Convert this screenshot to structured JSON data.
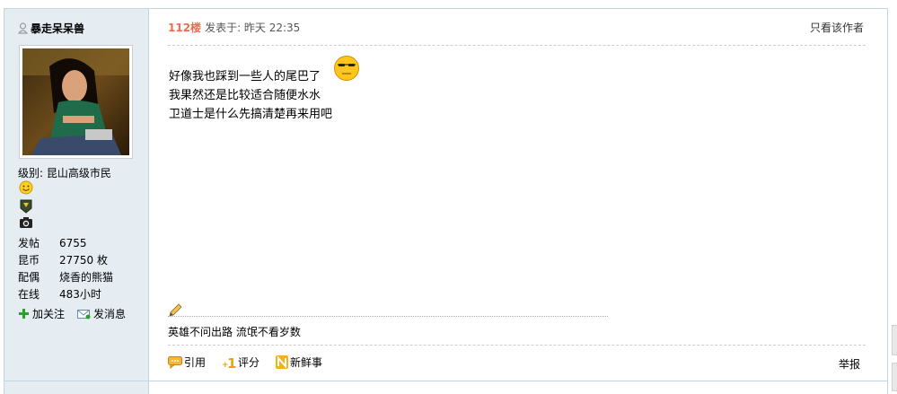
{
  "user": {
    "name": "暴走呆呆兽",
    "level_label": "级别: ",
    "level_value": "昆山高级市民",
    "stats": [
      {
        "label": "发帖",
        "value": "6755"
      },
      {
        "label": "昆币",
        "value": "27750 枚"
      },
      {
        "label": "配偶",
        "value": "烧香的熊猫"
      },
      {
        "label": "在线",
        "value": "483小时"
      }
    ],
    "follow_label": "加关注",
    "message_label": "发消息"
  },
  "post": {
    "floor": "112楼",
    "posted_at": "发表于: 昨天 22:35",
    "only_author": "只看该作者",
    "lines": [
      "好像我也踩到一些人的尾巴了",
      "我果然还是比较适合随便水水",
      "卫道士是什么先搞清楚再来用吧"
    ],
    "signature": "英雄不问出路 流氓不看岁数"
  },
  "toolbar": {
    "quote": "引用",
    "rate": "评分",
    "news": "新鲜事",
    "report": "举报"
  },
  "colors": {
    "floor": "#f26c4f",
    "sidebar_bg": "#e5edf2",
    "border": "#c2d5e3"
  }
}
